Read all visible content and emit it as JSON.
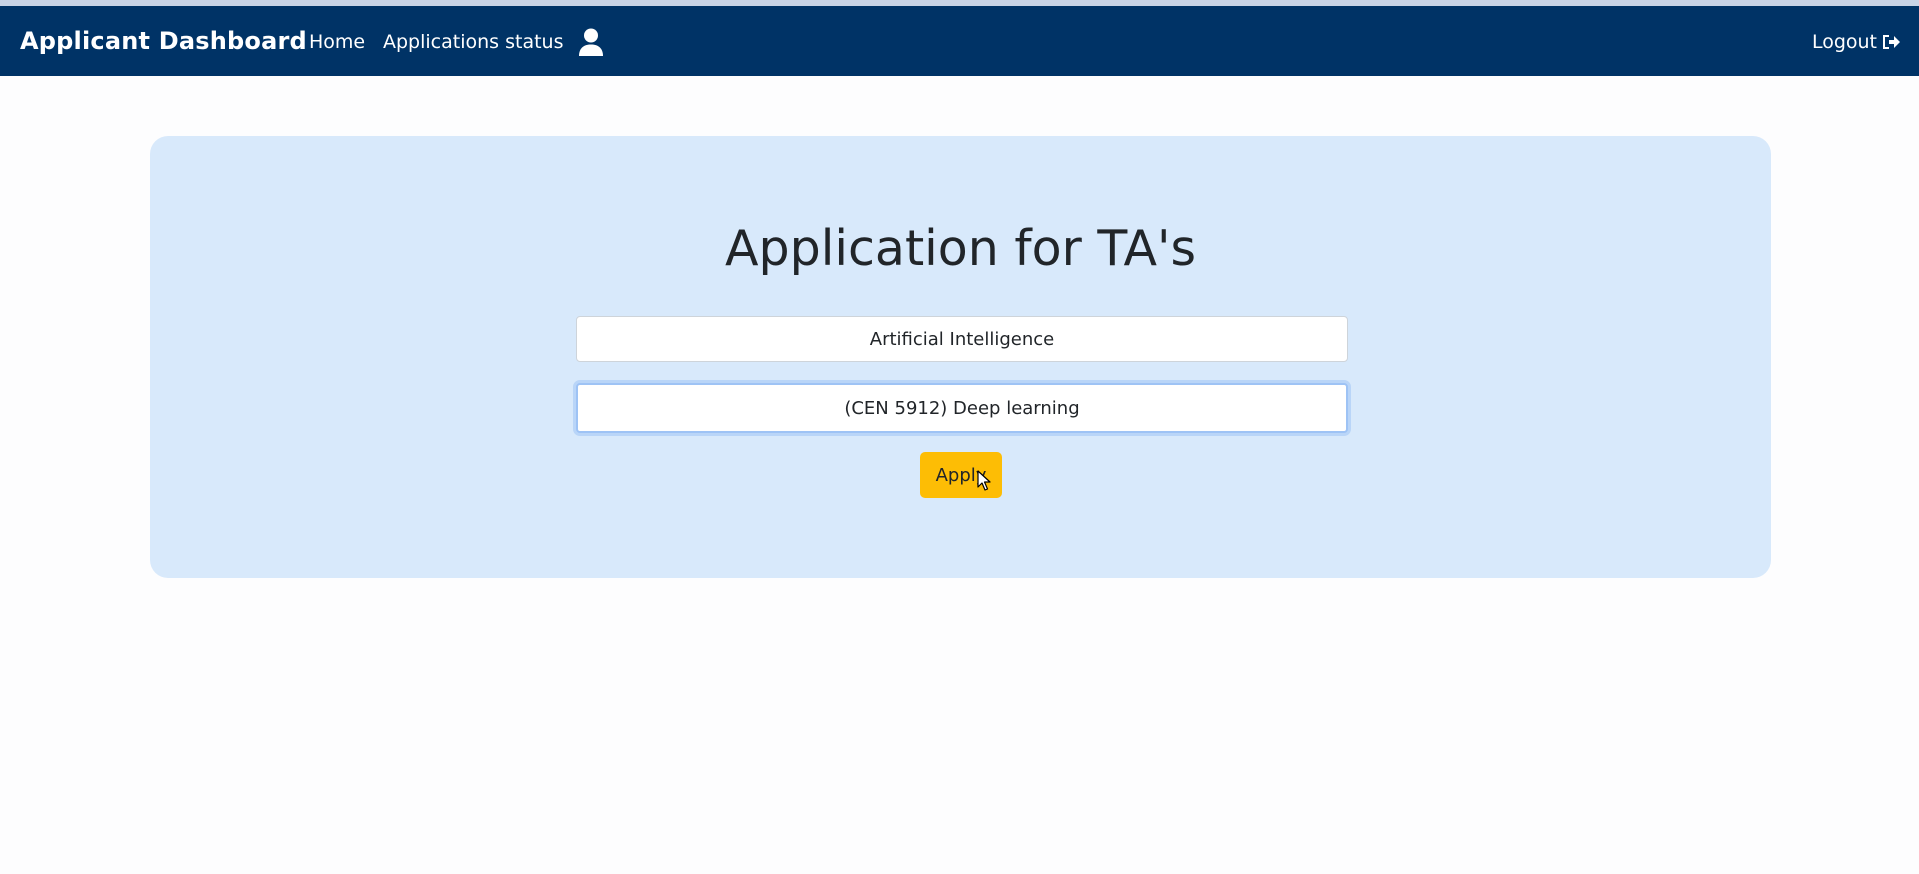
{
  "navbar": {
    "brand": "Applicant Dashboard",
    "links": [
      {
        "label": "Home"
      },
      {
        "label": "Applications status"
      }
    ],
    "user_icon": "user-icon",
    "logout_label": "Logout",
    "logout_icon": "sign-out-icon",
    "background_color": "#003366"
  },
  "main": {
    "title": "Application for TA's",
    "subject_field": {
      "value": "Artificial Intelligence"
    },
    "course_field": {
      "value": "(CEN 5912) Deep learning"
    },
    "apply_label": "Apply",
    "apply_color": "#fdbd05",
    "card_color": "#d8e9fb"
  }
}
